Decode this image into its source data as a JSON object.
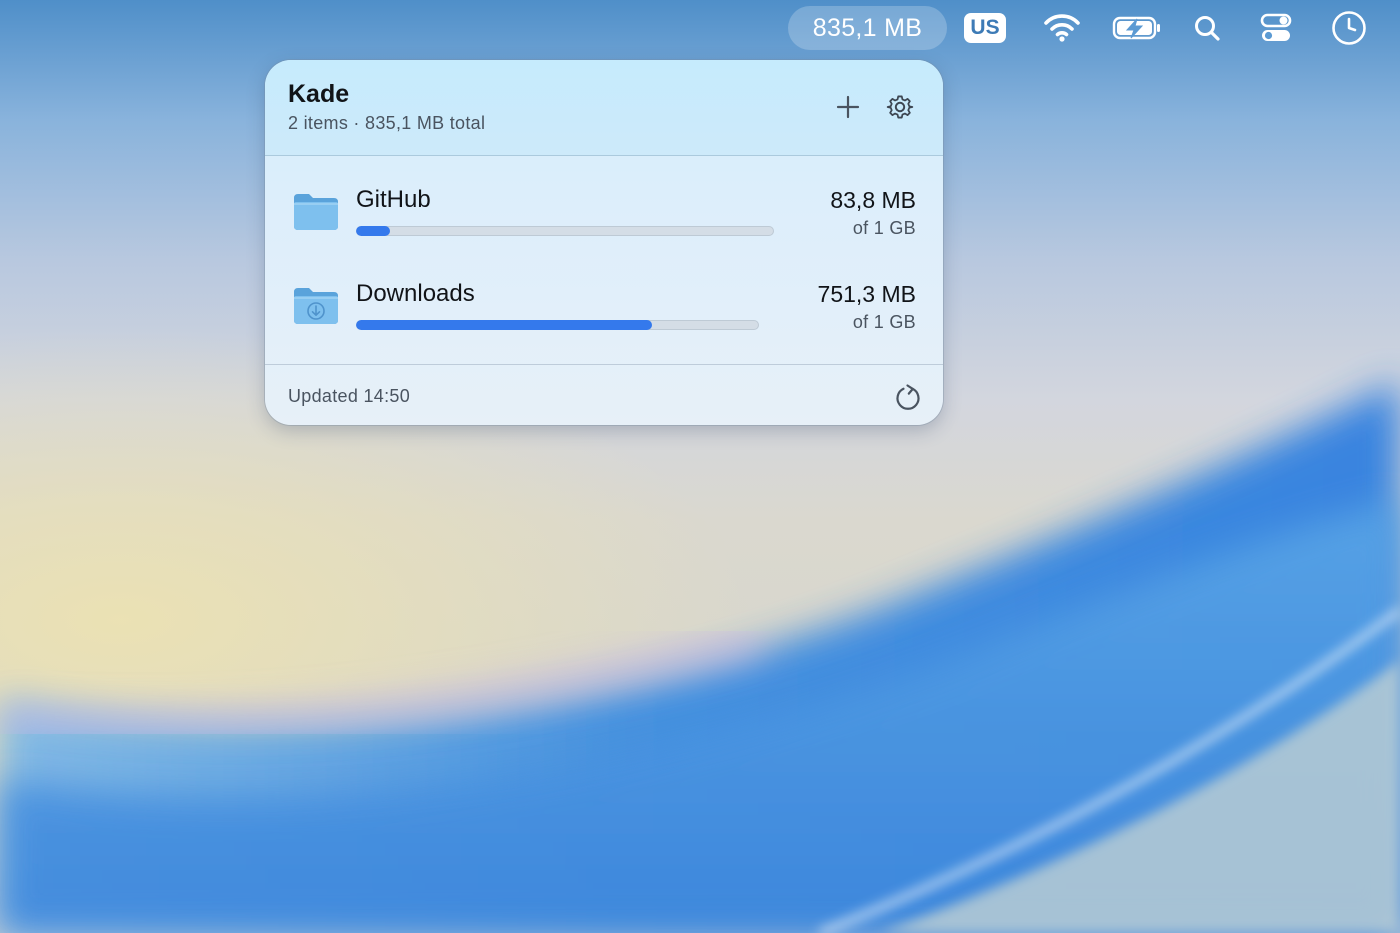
{
  "menubar": {
    "usage_label": "835,1 MB",
    "input_source": "US",
    "icons": [
      "wifi-icon",
      "battery-charging-icon",
      "search-icon",
      "control-center-icon",
      "clock-icon"
    ]
  },
  "panel": {
    "title": "Kade",
    "subtitle": "2 items · 835,1 MB total",
    "header_icons": [
      "plus-icon",
      "gear-icon"
    ],
    "items": [
      {
        "name": "GitHub",
        "size": "83,8 MB",
        "capacity": "of 1 GB",
        "fraction": 0.0818,
        "icon": "folder-icon"
      },
      {
        "name": "Downloads",
        "size": "751,3 MB",
        "capacity": "of 1 GB",
        "fraction": 0.7337,
        "icon": "downloads-folder-icon"
      }
    ],
    "footer": {
      "updated": "Updated 14:50",
      "icon": "refresh-icon"
    }
  },
  "colors": {
    "accent": "#3479ec",
    "track": "#d4dde6",
    "folder": "#6cb2e6"
  }
}
